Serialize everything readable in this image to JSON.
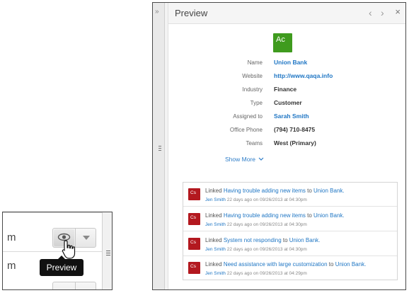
{
  "inset": {
    "rows": [
      "m",
      "m"
    ],
    "tooltip": "Preview"
  },
  "preview": {
    "title": "Preview",
    "close_glyph": "×",
    "prev_glyph": "‹",
    "next_glyph": "›",
    "collapse_glyph": "»",
    "avatar": {
      "text": "Ac",
      "color": "#3f9b1e"
    },
    "fields": [
      {
        "label": "Name",
        "value": "Union Bank",
        "link": true
      },
      {
        "label": "Website",
        "value": "http://www.qaqa.info",
        "link": true
      },
      {
        "label": "Industry",
        "value": "Finance",
        "link": false
      },
      {
        "label": "Type",
        "value": "Customer",
        "link": false
      },
      {
        "label": "Assigned to",
        "value": "Sarah Smith",
        "link": true
      },
      {
        "label": "Office Phone",
        "value": "(794) 710-8475",
        "link": false
      },
      {
        "label": "Teams",
        "value": "West (Primary)",
        "link": false
      }
    ],
    "show_more": "Show More"
  },
  "activity": [
    {
      "icon": "Cs",
      "prefix": "Linked",
      "subject": "Having trouble adding new items",
      "to": "to",
      "target": "Union Bank.",
      "who": "Jen Smith",
      "meta": "22 days ago on 09/26/2013 at 04:30pm"
    },
    {
      "icon": "Cs",
      "prefix": "Linked",
      "subject": "Having trouble adding new items",
      "to": "to",
      "target": "Union Bank.",
      "who": "Jen Smith",
      "meta": "22 days ago on 09/26/2013 at 04:30pm"
    },
    {
      "icon": "Cs",
      "prefix": "Linked",
      "subject": "System not responding",
      "to": "to",
      "target": "Union Bank.",
      "who": "Jen Smith",
      "meta": "22 days ago on 09/26/2013 at 04:30pm"
    },
    {
      "icon": "Cs",
      "prefix": "Linked",
      "subject": "Need assistance with large customization",
      "to": "to",
      "target": "Union Bank.",
      "who": "Jen Smith",
      "meta": "22 days ago on 09/26/2013 at 04:29pm"
    }
  ],
  "colors": {
    "accent": "#1f76c4",
    "case_icon": "#b3181f"
  }
}
